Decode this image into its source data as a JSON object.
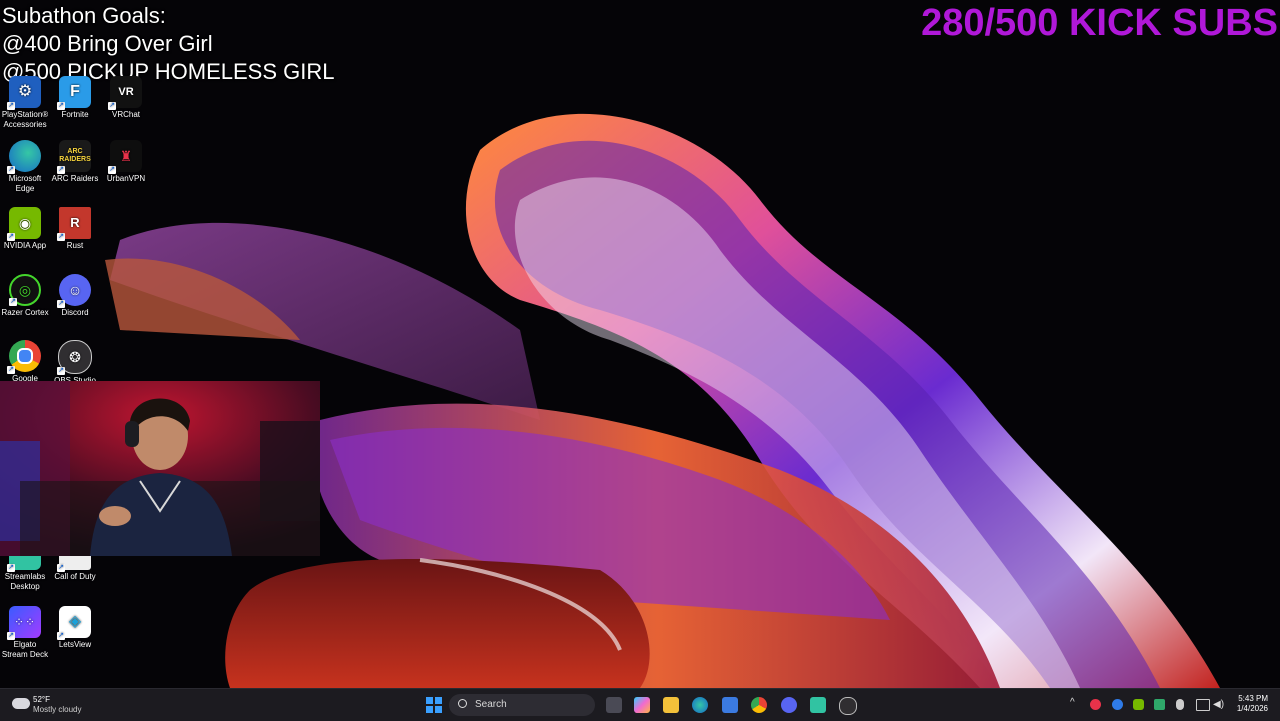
{
  "overlay": {
    "goals_title": "Subathon Goals:",
    "goal_1": "@400 Bring Over Girl",
    "goal_2": "@500 PICKUP HOMELESS GIRL",
    "sub_counter": "280/500 KICK SUBS"
  },
  "desktop_icons": {
    "playstation": "PlayStation® Accessories",
    "fortnite": "Fortnite",
    "vrchat": "VRChat",
    "edge": "Microsoft Edge",
    "arc_raiders": "ARC Raiders",
    "urbanvpn": "UrbanVPN",
    "nvidia": "NVIDIA App",
    "rust": "Rust",
    "razer": "Razer Cortex",
    "discord": "Discord",
    "google": "Google",
    "obs": "OBS Studio",
    "streamlabs": "Streamlabs Desktop",
    "cod": "Call of Duty",
    "elgato": "Elgato Stream Deck",
    "letsview": "LetsView"
  },
  "taskbar": {
    "weather_temp": "52°F",
    "weather_desc": "Mostly cloudy",
    "search_placeholder": "Search",
    "time": "5:43 PM",
    "date": "1/4/2026"
  },
  "colors": {
    "counter_purple": "#b018d8",
    "taskbar_bg": "#1c1b20",
    "desktop_bg": "#050407"
  }
}
